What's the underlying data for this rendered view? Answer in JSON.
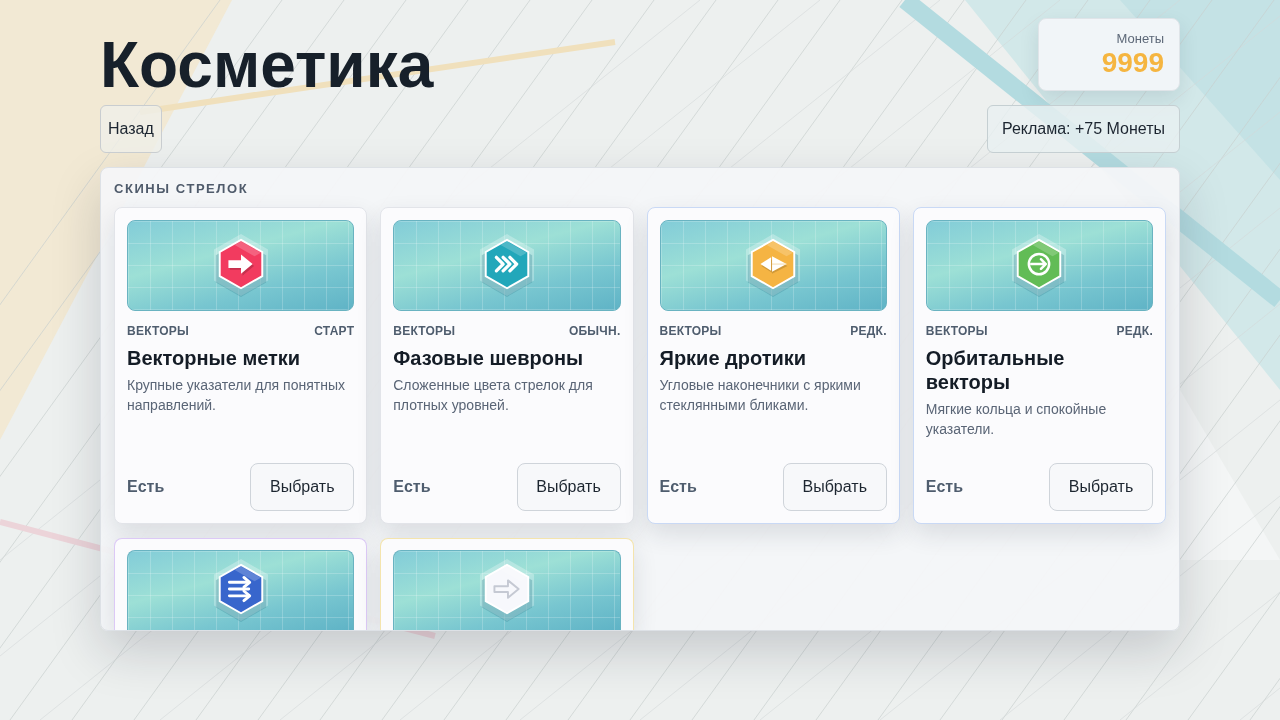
{
  "page": {
    "title": "Косметика"
  },
  "coins": {
    "label": "Монеты",
    "value": "9999"
  },
  "back_button": {
    "label": "Назад"
  },
  "ad_button": {
    "label": "Реклама: +75 Монеты"
  },
  "section": {
    "title": "СКИНЫ СТРЕЛОК",
    "cards": [
      {
        "color": "#e2e4e9",
        "preview": {
          "kind": "arrow",
          "color": "#f23b5f"
        },
        "category": "ВЕКТОРЫ",
        "rarity": "СТАРТ",
        "title": "Векторные метки",
        "description": "Крупные указатели для понятных направлений.",
        "status": "Есть",
        "button": "Выбрать"
      },
      {
        "color": "#e2e4e9",
        "preview": {
          "kind": "chevrons",
          "color": "#22a7ba"
        },
        "category": "ВЕКТОРЫ",
        "rarity": "ОБЫЧН.",
        "title": "Фазовые шевроны",
        "description": "Сложенные цвета стрелок для плотных уровней.",
        "status": "Есть",
        "button": "Выбрать"
      },
      {
        "color": "#c9d9f5",
        "preview": {
          "kind": "dart",
          "color": "#f5b443"
        },
        "category": "ВЕКТОРЫ",
        "rarity": "РЕДК.",
        "title": "Яркие дротики",
        "description": "Угловые наконечники с яркими стеклянными бликами.",
        "status": "Есть",
        "button": "Выбрать"
      },
      {
        "color": "#c9d9f5",
        "preview": {
          "kind": "orbit",
          "color": "#62bc56"
        },
        "category": "ВЕКТОРЫ",
        "rarity": "РЕДК.",
        "title": "Орбитальные векторы",
        "description": "Мягкие кольца и спокойные указатели.",
        "status": "Есть",
        "button": "Выбрать"
      },
      {
        "color": "#dcc9f6",
        "preview": {
          "kind": "lines",
          "color": "#3866cc"
        }
      },
      {
        "color": "#f4e4ad",
        "preview": {
          "kind": "outline",
          "color": "#f7f8fc"
        }
      }
    ]
  }
}
